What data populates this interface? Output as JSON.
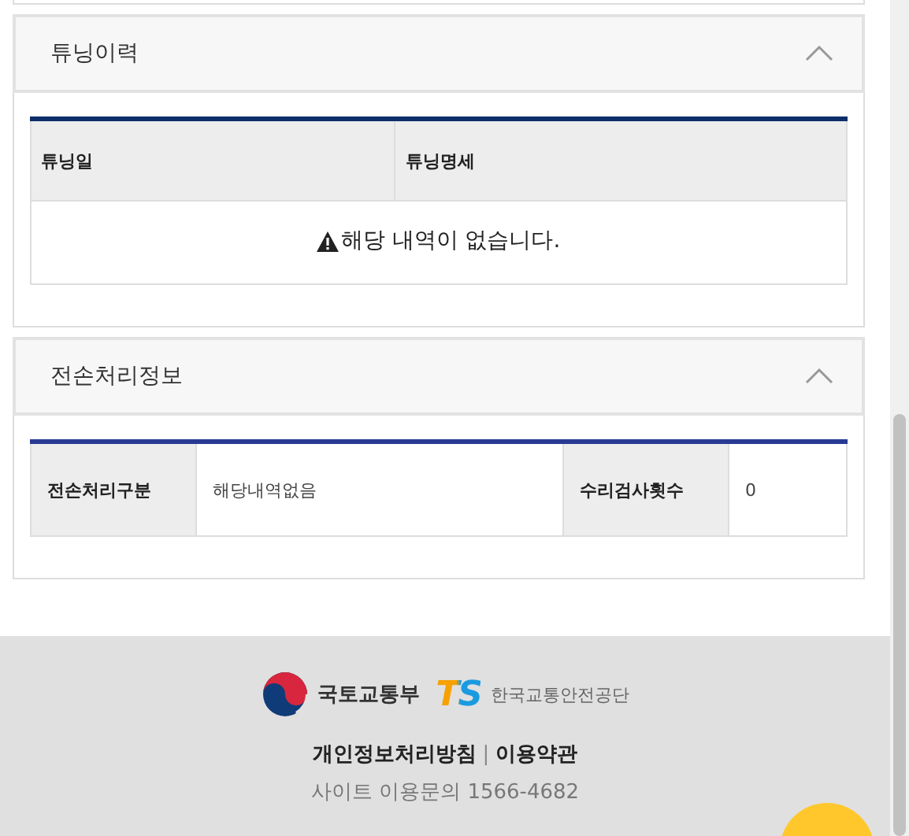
{
  "sections": [
    {
      "title": "튜닝이력",
      "expanded": true,
      "kind": "list",
      "columns": [
        "튜닝일",
        "튜닝명세"
      ],
      "empty_message": "해당 내역이 없습니다."
    },
    {
      "title": "전손처리정보",
      "expanded": true,
      "kind": "pairs",
      "pairs": [
        {
          "label": "전손처리구분",
          "value": "해당내역없음"
        },
        {
          "label": "수리검사횟수",
          "value": "0"
        }
      ]
    }
  ],
  "footer": {
    "ministry": "국토교통부",
    "agency_mark": "TS",
    "agency": "한국교통안전공단",
    "links": [
      {
        "label": "개인정보처리방침"
      },
      {
        "label": "이용약관"
      }
    ],
    "separator": "|",
    "contact": "사이트 이용문의 1566-4682"
  }
}
